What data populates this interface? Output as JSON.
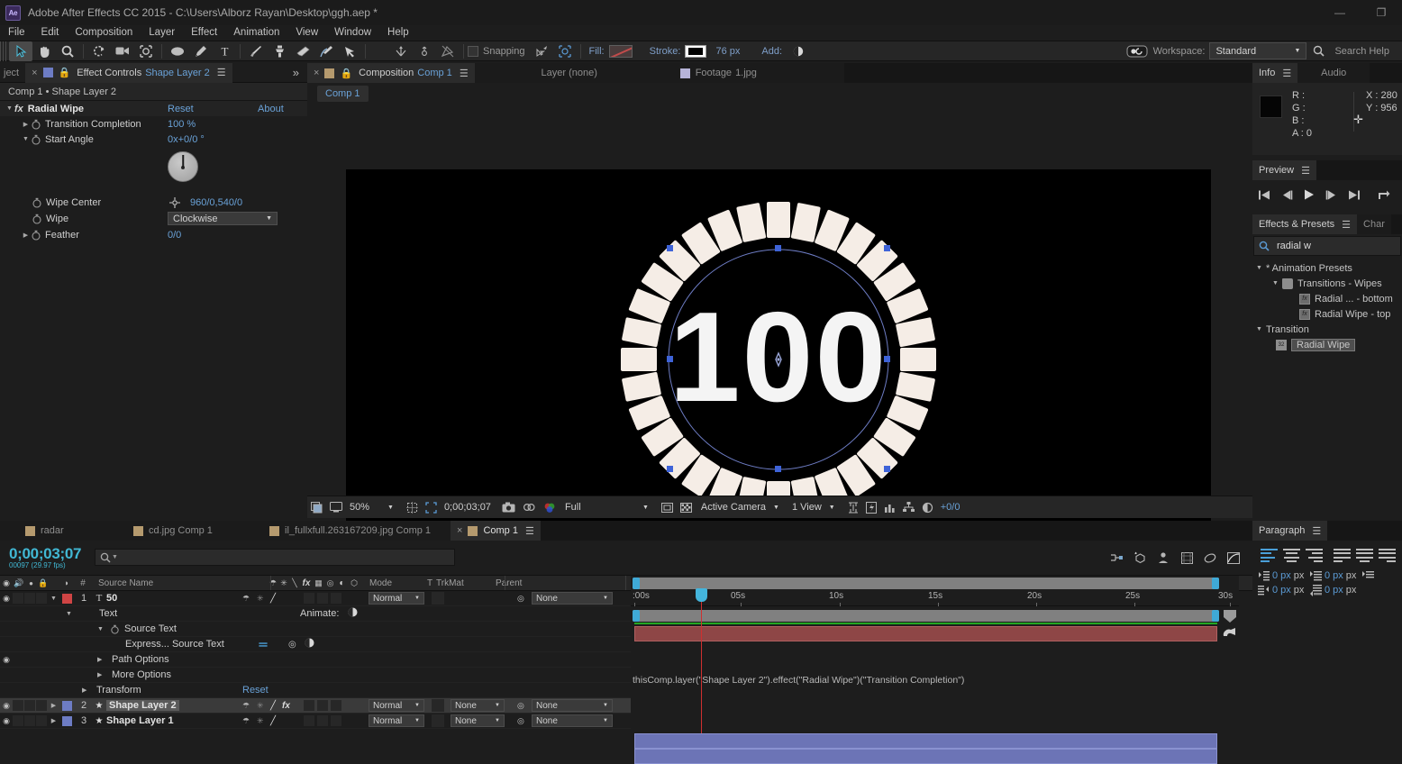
{
  "titlebar": {
    "app_icon": "ae-logo",
    "title": "Adobe After Effects CC 2015 - C:\\Users\\Alborz Rayan\\Desktop\\ggh.aep *",
    "minimize": "—",
    "restore": "❐"
  },
  "menubar": {
    "items": [
      "File",
      "Edit",
      "Composition",
      "Layer",
      "Effect",
      "Animation",
      "View",
      "Window",
      "Help"
    ]
  },
  "toolbar": {
    "snapping_label": "Snapping",
    "fill_label": "Fill:",
    "stroke_label": "Stroke:",
    "stroke_width": "76 px",
    "add_label": "Add:",
    "workspace_label": "Workspace:",
    "workspace_value": "Standard",
    "search_help": "Search Help"
  },
  "effect_controls": {
    "tab_title": "Effect Controls",
    "tab_subject": "Shape Layer 2",
    "tab_left_partial": "ject",
    "breadcrumb": "Comp 1 • Shape Layer 2",
    "effect_name": "Radial Wipe",
    "reset_label": "Reset",
    "about_label": "About",
    "properties": [
      {
        "name": "Transition Completion",
        "value": "100 %"
      },
      {
        "name": "Start Angle",
        "value": "0x+0/0 °"
      },
      {
        "name": "Wipe Center",
        "value": "960/0,540/0"
      },
      {
        "name": "Wipe",
        "value": "Clockwise"
      },
      {
        "name": "Feather",
        "value": "0/0"
      }
    ]
  },
  "composition": {
    "tabs": [
      {
        "label": "Composition",
        "name": "Comp 1",
        "active": true
      },
      {
        "label": "Layer (none)",
        "name": "",
        "active": false
      },
      {
        "label": "Footage",
        "name": "1.jpg",
        "active": false
      }
    ],
    "chip": "Comp 1",
    "canvas_text": "100",
    "bottom_bar": {
      "zoom": "50%",
      "timecode": "0;00;03;07",
      "resolution": "Full",
      "view_camera": "Active Camera",
      "views": "1 View",
      "exposure": "+0/0"
    }
  },
  "info": {
    "tab": "Info",
    "tab_audio": "Audio",
    "r": "R :",
    "g": "G :",
    "b": "B :",
    "a": "A : 0",
    "x": "X : 280",
    "y": "Y : 956"
  },
  "preview": {
    "tab": "Preview"
  },
  "effects_presets": {
    "tab": "Effects & Presets",
    "tab_partial": "Char",
    "search_value": "radial w",
    "tree": [
      {
        "depth": 0,
        "label": "* Animation Presets",
        "icon": "",
        "expanded": true
      },
      {
        "depth": 1,
        "label": "Transitions - Wipes",
        "icon": "folder-icon",
        "expanded": true
      },
      {
        "depth": 2,
        "label": "Radial ... - bottom",
        "icon": "preset-icon",
        "expanded": false
      },
      {
        "depth": 2,
        "label": "Radial Wipe - top",
        "icon": "preset-icon",
        "expanded": false
      },
      {
        "depth": 0,
        "label": "Transition",
        "icon": "",
        "expanded": true
      },
      {
        "depth": 1,
        "label": "Radial Wipe",
        "icon": "effect-32-icon",
        "expanded": false,
        "selected": true
      }
    ]
  },
  "timeline": {
    "tabs": [
      {
        "label": "radar",
        "active": false
      },
      {
        "label": "cd.jpg Comp 1",
        "active": false
      },
      {
        "label": "il_fullxfull.263167209.jpg Comp 1",
        "active": false
      },
      {
        "label": "Comp 1",
        "active": true
      }
    ],
    "timecode": "0;00;03;07",
    "frames": "00097 (29.97 fps)",
    "columns": [
      "#",
      "Source Name",
      "Mode",
      "T",
      "TrkMat",
      "Parent"
    ],
    "ruler_ticks": [
      ":00s",
      "05s",
      "10s",
      "15s",
      "20s",
      "25s",
      "30s"
    ],
    "expression": "thisComp.layer(\"Shape Layer 2\").effect(\"Radial Wipe\")(\"Transition Completion\")",
    "rows": [
      {
        "kind": "layer",
        "index": "1",
        "name": "50",
        "type_icon": "text-icon",
        "color": "#cf4444",
        "mode": "Normal",
        "trkmat": "",
        "parent": "None",
        "selected": false
      },
      {
        "kind": "prop",
        "indent": 2,
        "label": "Text",
        "extra": "Animate:"
      },
      {
        "kind": "prop",
        "indent": 3,
        "label": "Source Text"
      },
      {
        "kind": "expr",
        "indent": 4,
        "label": "Express... Source Text"
      },
      {
        "kind": "prop",
        "indent": 3,
        "label": "Path Options"
      },
      {
        "kind": "prop",
        "indent": 3,
        "label": "More Options"
      },
      {
        "kind": "prop",
        "indent": 2,
        "label": "Transform",
        "extra2": "Reset"
      },
      {
        "kind": "layer",
        "index": "2",
        "name": "Shape Layer 2",
        "color": "#6d7cc4",
        "mode": "Normal",
        "trkmat": "None",
        "parent": "None",
        "selected": true,
        "has_fx": true
      },
      {
        "kind": "layer",
        "index": "3",
        "name": "Shape Layer 1",
        "color": "#6d7cc4",
        "mode": "Normal",
        "trkmat": "None",
        "parent": "None",
        "selected": false
      }
    ]
  },
  "paragraph": {
    "tab": "Paragraph",
    "values": [
      "0 px",
      "0 px",
      "0 px",
      "0 px"
    ]
  },
  "colors": {
    "accent_blue": "#6aa2d8",
    "cyan_timecode": "#41b8d4",
    "panel_bg": "#1d1d1d",
    "layer_red": "#cf4444",
    "layer_blue": "#6d7cc4"
  }
}
